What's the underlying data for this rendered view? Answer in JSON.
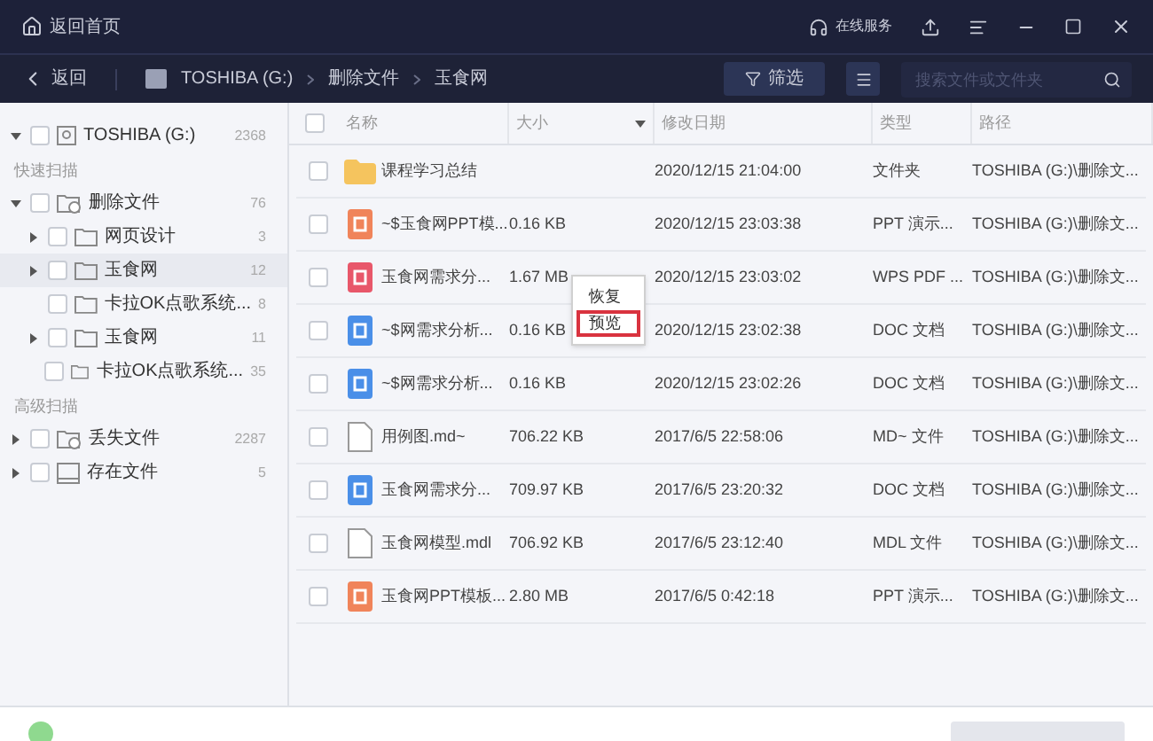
{
  "top_bar": {
    "home": "返回首页",
    "service": "在线服务"
  },
  "nav": {
    "back": "返回",
    "breadcrumb": [
      "TOSHIBA (G:)",
      "删除文件",
      "玉食网"
    ],
    "filter": "筛选",
    "search": {
      "placeholder": "搜索文件或文件夹"
    }
  },
  "sidebar": {
    "root": {
      "label": "TOSHIBA (G:)",
      "count": "2368",
      "expanded": true,
      "checked": false
    },
    "sections": [
      {
        "title": "快速扫描",
        "items": [
          {
            "label": "删除文件",
            "count": "76",
            "kind": "recycle",
            "has_children": true,
            "expanded": true,
            "selected": false,
            "checked": false,
            "children": [
              {
                "label": "网页设计",
                "count": "3",
                "kind": "folder",
                "has_children": true,
                "expanded": false,
                "selected": false,
                "checked": false
              },
              {
                "label": "玉食网",
                "count": "12",
                "kind": "folder",
                "has_children": true,
                "expanded": false,
                "selected": true,
                "checked": false
              },
              {
                "label": "卡拉OK点歌系统...",
                "count": "8",
                "kind": "folder",
                "has_children": false,
                "selected": false,
                "checked": false
              },
              {
                "label": "玉食网",
                "count": "11",
                "kind": "folder",
                "has_children": true,
                "expanded": false,
                "selected": false,
                "checked": false
              },
              {
                "label": "卡拉OK点歌系统...",
                "count": "35",
                "kind": "folder",
                "has_children": false,
                "selected": false,
                "checked": false
              }
            ]
          }
        ]
      },
      {
        "title": "高级扫描",
        "items": [
          {
            "label": "丢失文件",
            "count": "2287",
            "kind": "recycle",
            "has_children": true,
            "expanded": false,
            "selected": false,
            "checked": false
          },
          {
            "label": "存在文件",
            "count": "5",
            "kind": "drive",
            "has_children": true,
            "expanded": false,
            "selected": false,
            "checked": false
          }
        ]
      }
    ]
  },
  "table": {
    "all_checked": false,
    "columns": [
      "名称",
      "大小",
      "修改日期",
      "类型",
      "路径"
    ],
    "rows": [
      {
        "kind": "folder",
        "checked": false,
        "name": "课程学习总结",
        "date": "2020/12/15 21:04:00",
        "type": "文件夹",
        "path": "TOSHIBA (G:)\\删除文..."
      },
      {
        "kind": "ppt",
        "checked": false,
        "name": "~$玉食网PPT模...",
        "size": "0.16 KB",
        "date": "2020/12/15 23:03:38",
        "type": "PPT 演示...",
        "path": "TOSHIBA (G:)\\删除文..."
      },
      {
        "kind": "pdf",
        "checked": false,
        "name": "玉食网需求分...",
        "size": "1.67 MB",
        "date": "2020/12/15 23:03:02",
        "type": "WPS PDF ...",
        "path": "TOSHIBA (G:)\\删除文...",
        "context_menu": [
          {
            "label": "恢复",
            "selected": false
          },
          {
            "label": "预览",
            "selected": true
          }
        ]
      },
      {
        "kind": "doc",
        "checked": false,
        "name": "~$网需求分析...",
        "size": "0.16 KB",
        "date": "2020/12/15 23:02:38",
        "type": "DOC 文档",
        "path": "TOSHIBA (G:)\\删除文..."
      },
      {
        "kind": "doc",
        "checked": false,
        "name": "~$网需求分析...",
        "size": "0.16 KB",
        "date": "2020/12/15 23:02:26",
        "type": "DOC 文档",
        "path": "TOSHIBA (G:)\\删除文..."
      },
      {
        "kind": "file",
        "checked": false,
        "name": "用例图.md~",
        "size": "706.22 KB",
        "date": "2017/6/5 22:58:06",
        "type": "MD~ 文件",
        "path": "TOSHIBA (G:)\\删除文..."
      },
      {
        "kind": "doc",
        "checked": false,
        "name": "玉食网需求分...",
        "size": "709.97 KB",
        "date": "2017/6/5 23:20:32",
        "type": "DOC 文档",
        "path": "TOSHIBA (G:)\\删除文..."
      },
      {
        "kind": "file",
        "checked": false,
        "name": "玉食网模型.mdl",
        "size": "706.92 KB",
        "date": "2017/6/5 23:12:40",
        "type": "MDL 文件",
        "path": "TOSHIBA (G:)\\删除文..."
      },
      {
        "kind": "ppt",
        "checked": false,
        "name": "玉食网PPT模板...",
        "size": "2.80 MB",
        "date": "2017/6/5 0:42:18",
        "type": "PPT 演示...",
        "path": "TOSHIBA (G:)\\删除文..."
      }
    ]
  }
}
